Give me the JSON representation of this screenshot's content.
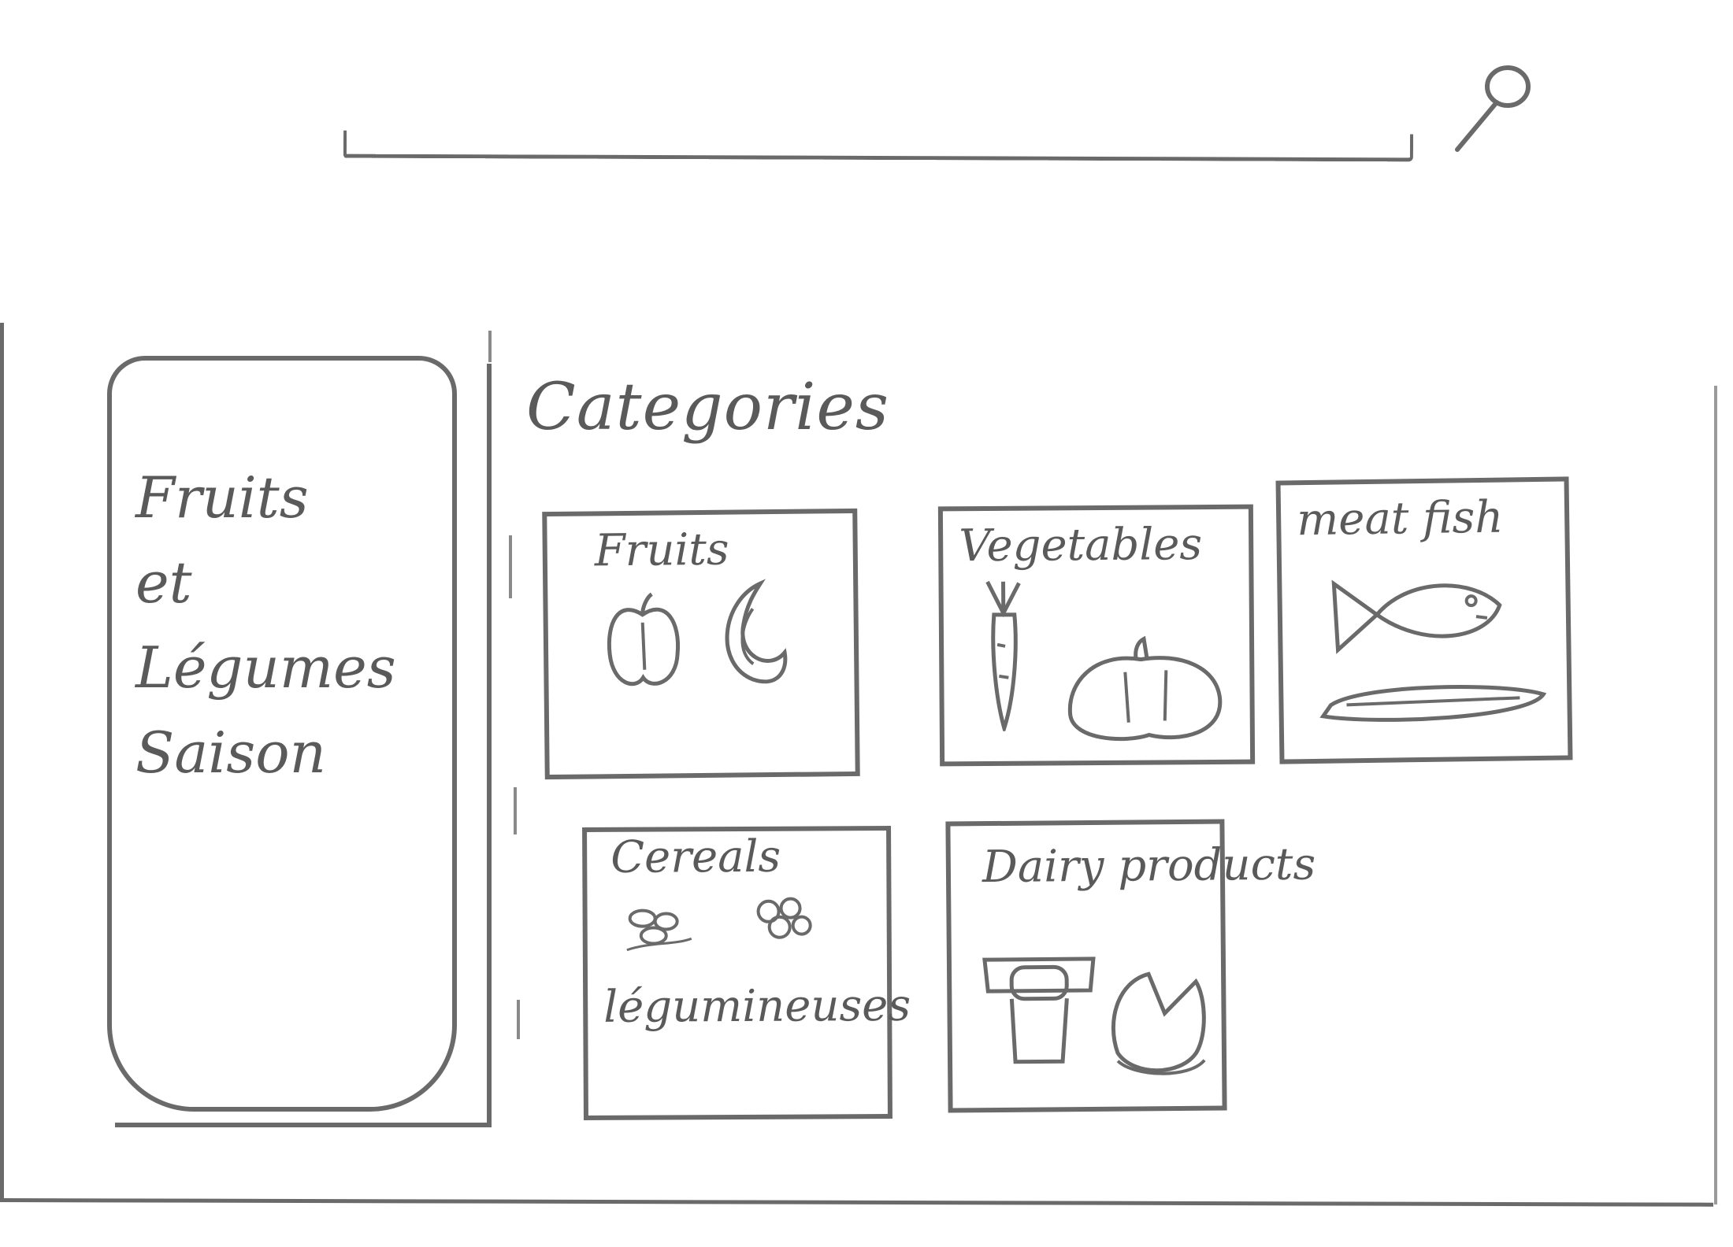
{
  "search": {
    "value": "",
    "placeholder": ""
  },
  "season_card": {
    "title": "Fruits\net\nLégumes\nSaison"
  },
  "categories": {
    "title": "Categories",
    "items": [
      {
        "label": "Fruits",
        "icons": [
          "apple-icon",
          "banana-icon"
        ]
      },
      {
        "label": "Vegetables",
        "icons": [
          "carrot-icon",
          "pumpkin-icon"
        ]
      },
      {
        "label": "meat fish",
        "icons": [
          "fish-icon",
          "meat-icon"
        ]
      },
      {
        "label": "Cereals",
        "label2": "légumineuses",
        "icons": [
          "grain-icon",
          "grain-icon"
        ]
      },
      {
        "label": "Dairy products",
        "icons": [
          "yogurt-icon",
          "cheese-icon"
        ]
      }
    ]
  },
  "colors": {
    "ink": "#6a6a6a",
    "paper": "#ffffff"
  }
}
